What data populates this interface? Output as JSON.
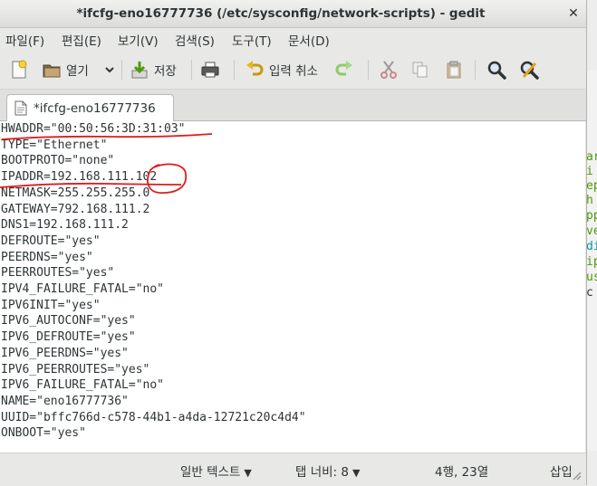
{
  "window": {
    "title": "*ifcfg-eno16777736 (/etc/sysconfig/network-scripts) - gedit",
    "close_glyph": "✕"
  },
  "menu": [
    {
      "label": "파일(F)"
    },
    {
      "label": "편집(E)"
    },
    {
      "label": "보기(V)"
    },
    {
      "label": "검색(S)"
    },
    {
      "label": "도구(T)"
    },
    {
      "label": "문서(D)"
    }
  ],
  "toolbar": {
    "open_label": "열기",
    "save_label": "저장",
    "undo_label": "입력 취소"
  },
  "tab": {
    "label": "*ifcfg-eno16777736"
  },
  "editor": {
    "lines": [
      "HWADDR=\"00:50:56:3D:31:03\"",
      "TYPE=\"Ethernet\"",
      "BOOTPROTO=\"none\"",
      "IPADDR=192.168.111.102",
      "NETMASK=255.255.255.0",
      "GATEWAY=792.168.111.2",
      "DNS1=192.168.111.2",
      "DEFROUTE=\"yes\"",
      "PEERDNS=\"yes\"",
      "PEERROUTES=\"yes\"",
      "IPV4_FAILURE_FATAL=\"no\"",
      "IPV6INIT=\"yes\"",
      "IPV6_AUTOCONF=\"yes\"",
      "IPV6_DEFROUTE=\"yes\"",
      "IPV6_PEERDNS=\"yes\"",
      "IPV6_PEERROUTES=\"yes\"",
      "IPV6_FAILURE_FATAL=\"no\"",
      "NAME=\"eno16777736\"",
      "UUID=\"bffc766d-c578-44b1-a4da-12721c20c4d4\"",
      "ONBOOT=\"yes\""
    ]
  },
  "status": {
    "language": "일반 텍스트",
    "tab_width": "탭 너비:  8",
    "position": "4행, 23열",
    "insert_mode": "삽입"
  },
  "background_window": {
    "chars": [
      {
        "t": "ar",
        "color": "#4e9a06"
      },
      {
        "t": "i",
        "color": "#4e9a06"
      },
      {
        "t": "ep",
        "color": "#4e9a06"
      },
      {
        "t": "h",
        "color": "#4e9a06"
      },
      {
        "t": "pp",
        "color": "#4e9a06"
      },
      {
        "t": "ve",
        "color": "#4e9a06"
      },
      {
        "t": "di",
        "color": "#06989a"
      },
      {
        "t": "ip",
        "color": "#4e9a06"
      },
      {
        "t": "us",
        "color": "#4e9a06"
      },
      {
        "t": "c",
        "color": "#2e3436"
      }
    ]
  },
  "colors": {
    "annotation": "#e01b1b",
    "editor_bg": "#ffffff",
    "chrome_bg": "#e8e8e7"
  }
}
